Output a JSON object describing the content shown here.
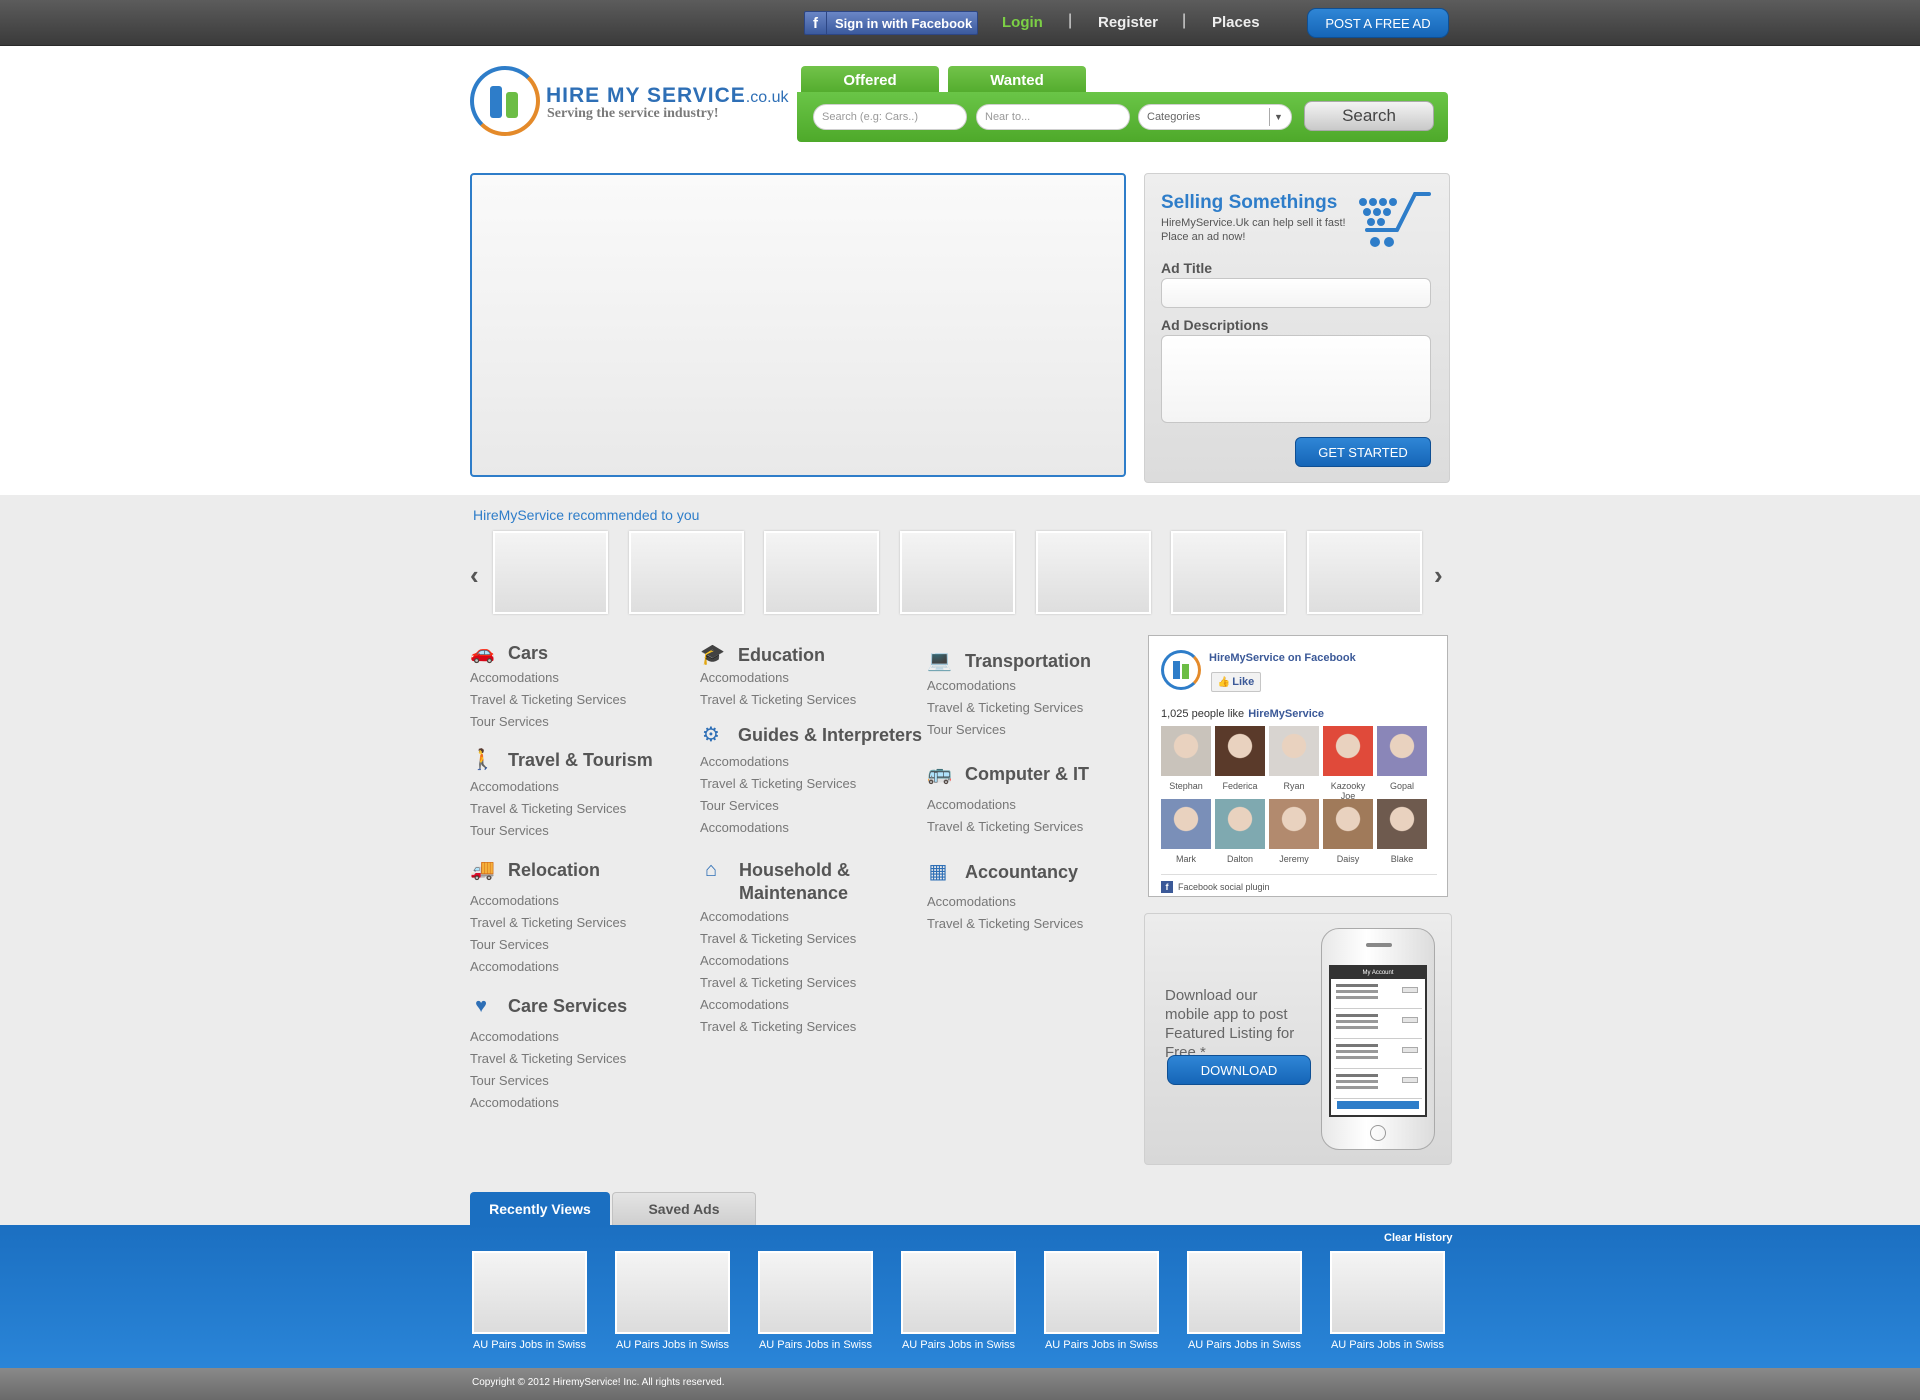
{
  "topbar": {
    "fb_signin_label": "Sign in with Facebook",
    "fb_glyph": "f",
    "login": "Login",
    "separator": "|",
    "register": "Register",
    "places": "Places",
    "post_ad": "POST A FREE AD"
  },
  "logo": {
    "brand": "HIRE MY SERVICE",
    "tld": ".co.uk",
    "tagline": "Serving the service industry!"
  },
  "search": {
    "tabs": [
      "Offered",
      "Wanted"
    ],
    "keyword_placeholder": "Search (e.g: Cars..)",
    "location_placeholder": "Near to...",
    "category_value": "Categories",
    "category_arrow": "▼",
    "button": "Search"
  },
  "sell": {
    "title": "Selling Somethings",
    "subtitle": "HireMyService.Uk can help sell it fast! Place an ad now!",
    "ad_title_label": "Ad Title",
    "ad_desc_label": "Ad Descriptions",
    "button": "GET STARTED"
  },
  "recommended": {
    "title": "HireMyService recommended to you",
    "prev": "‹",
    "next": "›"
  },
  "categories": [
    {
      "title": "Cars",
      "icon": "car-icon",
      "glyph": "🚗",
      "links": [
        "Accomodations",
        "Travel & Ticketing Services",
        "Tour Services"
      ]
    },
    {
      "title": "Travel & Tourism",
      "icon": "traveler-icon",
      "glyph": "🚶",
      "links": [
        "Accomodations",
        "Travel & Ticketing Services",
        "Tour Services"
      ]
    },
    {
      "title": "Relocation",
      "icon": "truck-icon",
      "glyph": "🚚",
      "links": [
        "Accomodations",
        "Travel & Ticketing Services",
        "Tour Services",
        "Accomodations"
      ]
    },
    {
      "title": "Care Services",
      "icon": "heart-icon",
      "glyph": "♥",
      "links": [
        "Accomodations",
        "Travel & Ticketing Services",
        "Tour Services",
        "Accomodations"
      ]
    },
    {
      "title": "Education",
      "icon": "graduation-icon",
      "glyph": "🎓",
      "links": [
        "Accomodations",
        "Travel & Ticketing Services"
      ]
    },
    {
      "title": "Guides & Interpreters",
      "icon": "gears-icon",
      "glyph": "⚙",
      "links": [
        "Accomodations",
        "Travel & Ticketing Services",
        "Tour Services",
        "Accomodations"
      ]
    },
    {
      "title_line1": "Household &",
      "title_line2": "Maintenance",
      "icon": "house-icon",
      "glyph": "⌂",
      "links": [
        "Accomodations",
        "Travel & Ticketing Services",
        "Accomodations",
        "Travel & Ticketing Services",
        "Accomodations",
        "Travel & Ticketing Services"
      ]
    },
    {
      "title": "Transportation",
      "icon": "laptop-icon",
      "glyph": "💻",
      "links": [
        "Accomodations",
        "Travel & Ticketing Services",
        "Tour Services"
      ]
    },
    {
      "title": "Computer & IT",
      "icon": "bus-icon",
      "glyph": "🚌",
      "links": [
        "Accomodations",
        "Travel & Ticketing Services"
      ]
    },
    {
      "title": "Accountancy",
      "icon": "calculator-icon",
      "glyph": "▦",
      "links": [
        "Accomodations",
        "Travel & Ticketing Services"
      ]
    }
  ],
  "facebook": {
    "page_name": "HireMyService on Facebook",
    "like_label": "Like",
    "like_glyph": "👍",
    "count_text": "1,025 people like",
    "count_page": "HireMyService",
    "fans": [
      {
        "name": "Stephan",
        "color": "#c9c3bb"
      },
      {
        "name": "Federica",
        "color": "#5a3a2a"
      },
      {
        "name": "Ryan",
        "color": "#d8d4d0"
      },
      {
        "name": "Kazooky Joe",
        "color": "#e04a3a"
      },
      {
        "name": "Gopal",
        "color": "#8a86b8"
      },
      {
        "name": "Mark",
        "color": "#7a8fb8"
      },
      {
        "name": "Dalton",
        "color": "#7fa9b0"
      },
      {
        "name": "Jeremy",
        "color": "#b28a6e"
      },
      {
        "name": "Daisy",
        "color": "#a07a5a"
      },
      {
        "name": "Blake",
        "color": "#6e5a4e"
      }
    ],
    "plugin_label": "Facebook social plugin",
    "plugin_glyph": "f"
  },
  "app_promo": {
    "text": "Download our mobile app to post Featured Listing for Free.*",
    "button": "DOWNLOAD",
    "screen_title": "My Account"
  },
  "bottom": {
    "tab_recent": "Recently Views",
    "tab_saved": "Saved Ads",
    "clear_history": "Clear History",
    "items": [
      "AU Pairs Jobs in Swiss",
      "AU Pairs Jobs in Swiss",
      "AU Pairs Jobs in Swiss",
      "AU Pairs Jobs in Swiss",
      "AU Pairs Jobs in Swiss",
      "AU Pairs Jobs in Swiss",
      "AU Pairs Jobs in Swiss"
    ]
  },
  "footer": {
    "copyright": "Copyright © 2012 HiremyService! Inc. All rights reserved."
  },
  "colors": {
    "brand_blue": "#2e7dc9",
    "brand_green": "#5bb535",
    "brand_orange": "#e48a2a",
    "facebook_blue": "#3b5998"
  }
}
